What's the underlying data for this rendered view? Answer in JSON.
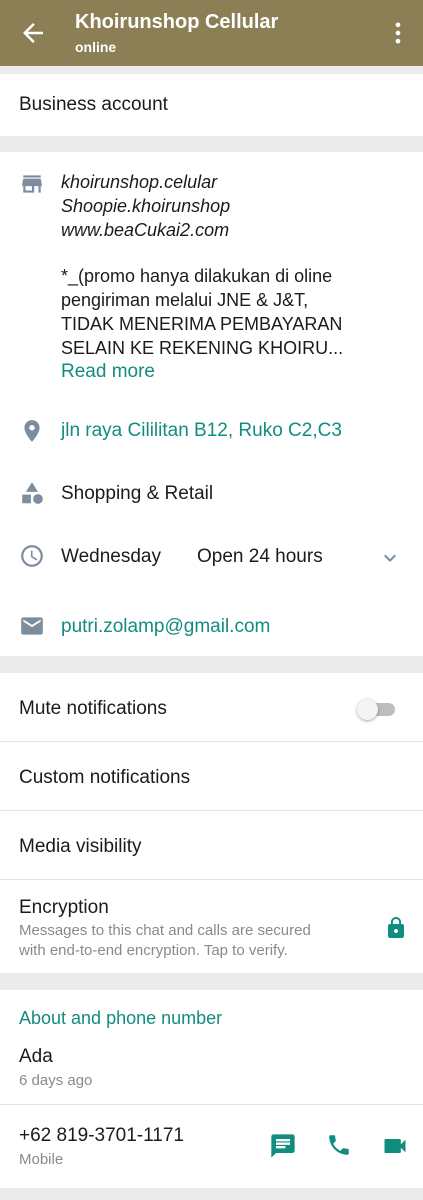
{
  "header": {
    "title": "Khoirunshop Cellular",
    "status": "online",
    "bg_color": "#8d7f55"
  },
  "business": {
    "label": "Business account"
  },
  "description": {
    "line1": "khoirunshop.celular",
    "line2": "Shoopie.khoirunshop",
    "line3": "www.beaCukai2.com",
    "line4": "*_(promo hanya dilakukan di oline",
    "line5": "pengiriman melalui JNE & J&T,",
    "line6": "TIDAK MENERIMA PEMBAYARAN",
    "line7": "SELAIN KE REKENING KHOIRU...",
    "read_more": "Read more",
    "icon": "store-icon"
  },
  "address": {
    "text": "jln raya Cililitan B12, Ruko C2,C3",
    "icon": "location-pin-icon"
  },
  "category": {
    "text": "Shopping & Retail",
    "icon": "shapes-icon"
  },
  "hours": {
    "day": "Wednesday",
    "status": "Open 24 hours",
    "icon": "clock-icon"
  },
  "email": {
    "text": "putri.zolamp@gmail.com",
    "icon": "email-icon"
  },
  "settings": {
    "mute": "Mute notifications",
    "mute_on": false,
    "custom": "Custom notifications",
    "media": "Media visibility",
    "encryption_title": "Encryption",
    "encryption_line1": "Messages to this chat and calls are secured",
    "encryption_line2": "with end-to-end encryption. Tap to verify."
  },
  "about": {
    "section_label": "About and phone number",
    "about_text": "Ada",
    "about_date": "6 days ago",
    "phone": "+62 819-3701-1171",
    "phone_type": "Mobile"
  },
  "colors": {
    "accent": "#128c7e",
    "icon_grey": "#7b8d9e"
  }
}
